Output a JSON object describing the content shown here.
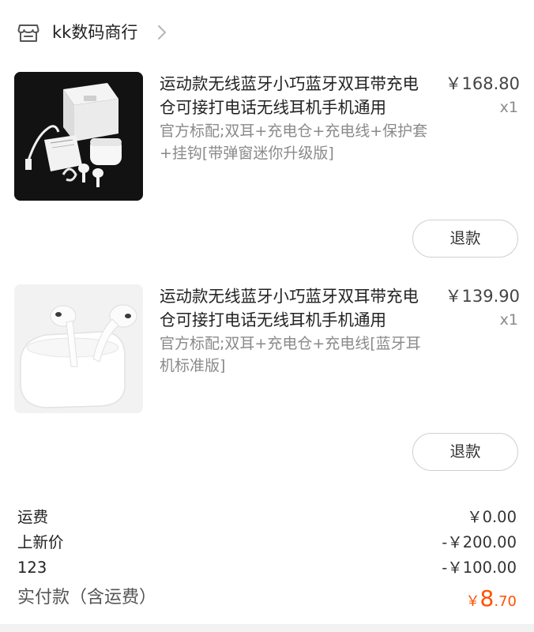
{
  "shop": {
    "name": "kk数码商行",
    "icon": "store-icon"
  },
  "items": [
    {
      "title": "运动款无线蓝牙小巧蓝牙双耳带充电仓可接打电话无线耳机手机通用",
      "spec": "官方标配;双耳+充电仓+充电线+保护套+挂钩[带弹窗迷你升级版]",
      "price": "￥168.80",
      "qty": "x1",
      "refund_label": "退款"
    },
    {
      "title": "运动款无线蓝牙小巧蓝牙双耳带充电仓可接打电话无线耳机手机通用",
      "spec": "官方标配;双耳+充电仓+充电线[蓝牙耳机标准版]",
      "price": "￥139.90",
      "qty": "x1",
      "refund_label": "退款"
    }
  ],
  "summary": {
    "shipping_label": "运费",
    "shipping_value": "￥0.00",
    "discount1_label": "上新价",
    "discount1_value": "-￥200.00",
    "discount2_label": "123",
    "discount2_value": "-￥100.00",
    "total_label": "实付款（含运费）",
    "total_currency": "￥",
    "total_int": "8",
    "total_dec": ".70"
  },
  "colors": {
    "accent": "#ff5000",
    "muted": "#8a8a8a"
  }
}
